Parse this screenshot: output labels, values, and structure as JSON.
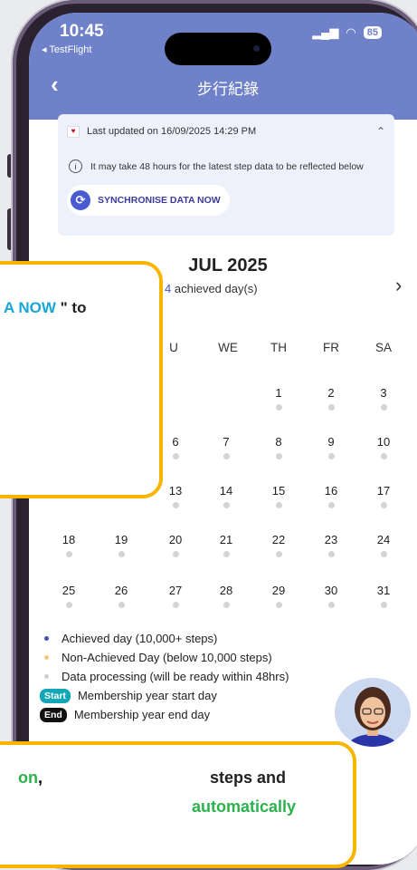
{
  "status": {
    "time": "10:45",
    "back_app": "TestFlight",
    "battery": "85"
  },
  "header": {
    "title": "步行紀錄"
  },
  "notice": {
    "updated": "Last updated on 16/09/2025 14:29 PM",
    "info": "It may take 48 hours for the latest step data to be reflected below",
    "sync_label": "SYNCHRONISE DATA NOW"
  },
  "calendar": {
    "month": "JUL 2025",
    "achieved_count": "4",
    "achieved_suffix": "achieved day(s)",
    "weekdays": [
      "U",
      "WE",
      "TH",
      "FR",
      "SA"
    ],
    "weeks": [
      [
        "1",
        "2",
        "3"
      ],
      [
        "6",
        "7",
        "8",
        "9",
        "10"
      ],
      [
        "13",
        "14",
        "15",
        "16",
        "17"
      ],
      [
        "18",
        "19",
        "20",
        "21",
        "22",
        "23",
        "24"
      ],
      [
        "25",
        "26",
        "27",
        "28",
        "29",
        "30",
        "31"
      ]
    ]
  },
  "legend": {
    "achieved": "Achieved day (10,000+ steps)",
    "non_achieved": "Non-Achieved Day (below 10,000 steps)",
    "processing": "Data processing (will be ready within 48hrs)",
    "start_pill": "Start",
    "start_text": "Membership year start day",
    "end_pill": "End",
    "end_text": "Membership year end day"
  },
  "colors": {
    "header": "#6f82c9",
    "achieved": "#3f51b5",
    "non_achieved": "#f5c77e",
    "processing": "#cfcfcf",
    "start_pill": "#12a7b8",
    "end_pill": "#111111",
    "tooltip_border": "#f7b500"
  },
  "tooltip1": {
    "highlight": "A NOW",
    "rest": " \" to"
  },
  "tooltip2": {
    "green1": "on",
    "comma": ",",
    "mid": "steps and",
    "green2": "automatically"
  }
}
